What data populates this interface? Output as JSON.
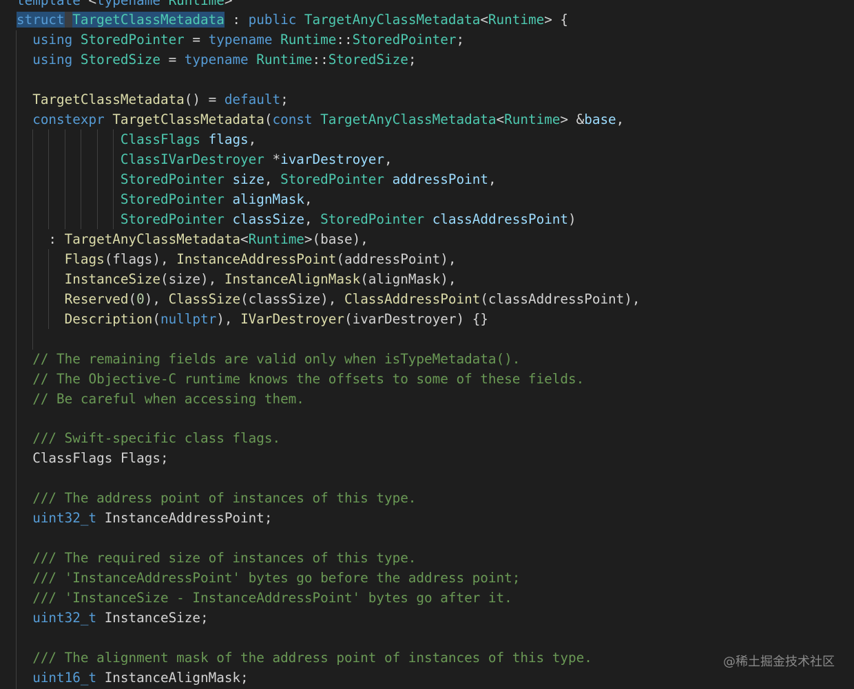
{
  "editor": {
    "language": "cpp",
    "theme_colors": {
      "background": "#1e1e1e",
      "keyword": "#569cd6",
      "type": "#4ec9b0",
      "function": "#dcdcaa",
      "variable": "#9cdcfe",
      "comment": "#6a9955",
      "number": "#b5cea8",
      "plain": "#d4d4d4",
      "selection": "#264f78"
    },
    "lines": [
      [
        [
          "c-k",
          "template"
        ],
        [
          "p",
          " <"
        ],
        [
          "k",
          "typename"
        ],
        [
          "p",
          " "
        ],
        [
          "t",
          "Runtime"
        ],
        [
          "p",
          ">"
        ]
      ],
      [
        [
          "k hl",
          "struct"
        ],
        [
          "p hlw",
          " "
        ],
        [
          "t hl",
          "TargetClassMetadata"
        ],
        [
          "p",
          " : "
        ],
        [
          "k",
          "public"
        ],
        [
          "p",
          " "
        ],
        [
          "t",
          "TargetAnyClassMetadata"
        ],
        [
          "p",
          "<"
        ],
        [
          "t",
          "Runtime"
        ],
        [
          "p",
          "> {"
        ]
      ],
      [
        [
          "p",
          "  "
        ],
        [
          "k",
          "using"
        ],
        [
          "p",
          " "
        ],
        [
          "t",
          "StoredPointer"
        ],
        [
          "p",
          " = "
        ],
        [
          "k",
          "typename"
        ],
        [
          "p",
          " "
        ],
        [
          "t",
          "Runtime"
        ],
        [
          "p",
          "::"
        ],
        [
          "t",
          "StoredPointer"
        ],
        [
          "p",
          ";"
        ]
      ],
      [
        [
          "p",
          "  "
        ],
        [
          "k",
          "using"
        ],
        [
          "p",
          " "
        ],
        [
          "t",
          "StoredSize"
        ],
        [
          "p",
          " = "
        ],
        [
          "k",
          "typename"
        ],
        [
          "p",
          " "
        ],
        [
          "t",
          "Runtime"
        ],
        [
          "p",
          "::"
        ],
        [
          "t",
          "StoredSize"
        ],
        [
          "p",
          ";"
        ]
      ],
      [],
      [
        [
          "p",
          "  "
        ],
        [
          "f",
          "TargetClassMetadata"
        ],
        [
          "p",
          "() = "
        ],
        [
          "k",
          "default"
        ],
        [
          "p",
          ";"
        ]
      ],
      [
        [
          "p",
          "  "
        ],
        [
          "k",
          "constexpr"
        ],
        [
          "p",
          " "
        ],
        [
          "f",
          "TargetClassMetadata"
        ],
        [
          "p",
          "("
        ],
        [
          "k",
          "const"
        ],
        [
          "p",
          " "
        ],
        [
          "t",
          "TargetAnyClassMetadata"
        ],
        [
          "p",
          "<"
        ],
        [
          "t",
          "Runtime"
        ],
        [
          "p",
          "> &"
        ],
        [
          "v",
          "base"
        ],
        [
          "p",
          ","
        ]
      ],
      [
        [
          "p",
          "             "
        ],
        [
          "t",
          "ClassFlags"
        ],
        [
          "p",
          " "
        ],
        [
          "v",
          "flags"
        ],
        [
          "p",
          ","
        ]
      ],
      [
        [
          "p",
          "             "
        ],
        [
          "t",
          "ClassIVarDestroyer"
        ],
        [
          "p",
          " *"
        ],
        [
          "v",
          "ivarDestroyer"
        ],
        [
          "p",
          ","
        ]
      ],
      [
        [
          "p",
          "             "
        ],
        [
          "t",
          "StoredPointer"
        ],
        [
          "p",
          " "
        ],
        [
          "v",
          "size"
        ],
        [
          "p",
          ", "
        ],
        [
          "t",
          "StoredPointer"
        ],
        [
          "p",
          " "
        ],
        [
          "v",
          "addressPoint"
        ],
        [
          "p",
          ","
        ]
      ],
      [
        [
          "p",
          "             "
        ],
        [
          "t",
          "StoredPointer"
        ],
        [
          "p",
          " "
        ],
        [
          "v",
          "alignMask"
        ],
        [
          "p",
          ","
        ]
      ],
      [
        [
          "p",
          "             "
        ],
        [
          "t",
          "StoredPointer"
        ],
        [
          "p",
          " "
        ],
        [
          "v",
          "classSize"
        ],
        [
          "p",
          ", "
        ],
        [
          "t",
          "StoredPointer"
        ],
        [
          "p",
          " "
        ],
        [
          "v",
          "classAddressPoint"
        ],
        [
          "p",
          ")"
        ]
      ],
      [
        [
          "p",
          "    : "
        ],
        [
          "f",
          "TargetAnyClassMetadata"
        ],
        [
          "p",
          "<"
        ],
        [
          "t",
          "Runtime"
        ],
        [
          "p",
          ">(base),"
        ]
      ],
      [
        [
          "p",
          "      "
        ],
        [
          "f",
          "Flags"
        ],
        [
          "p",
          "(flags), "
        ],
        [
          "f",
          "InstanceAddressPoint"
        ],
        [
          "p",
          "(addressPoint),"
        ]
      ],
      [
        [
          "p",
          "      "
        ],
        [
          "f",
          "InstanceSize"
        ],
        [
          "p",
          "(size), "
        ],
        [
          "f",
          "InstanceAlignMask"
        ],
        [
          "p",
          "(alignMask),"
        ]
      ],
      [
        [
          "p",
          "      "
        ],
        [
          "f",
          "Reserved"
        ],
        [
          "p",
          "("
        ],
        [
          "n",
          "0"
        ],
        [
          "p",
          "), "
        ],
        [
          "f",
          "ClassSize"
        ],
        [
          "p",
          "(classSize), "
        ],
        [
          "f",
          "ClassAddressPoint"
        ],
        [
          "p",
          "(classAddressPoint),"
        ]
      ],
      [
        [
          "p",
          "      "
        ],
        [
          "f",
          "Description"
        ],
        [
          "p",
          "("
        ],
        [
          "k",
          "nullptr"
        ],
        [
          "p",
          "), "
        ],
        [
          "f",
          "IVarDestroyer"
        ],
        [
          "p",
          "(ivarDestroyer) {}"
        ]
      ],
      [],
      [
        [
          "p",
          "  "
        ],
        [
          "c",
          "// The remaining fields are valid only when isTypeMetadata()."
        ]
      ],
      [
        [
          "p",
          "  "
        ],
        [
          "c",
          "// The Objective-C runtime knows the offsets to some of these fields."
        ]
      ],
      [
        [
          "p",
          "  "
        ],
        [
          "c",
          "// Be careful when accessing them."
        ]
      ],
      [],
      [
        [
          "p",
          "  "
        ],
        [
          "c",
          "/// Swift-specific class flags."
        ]
      ],
      [
        [
          "p",
          "  "
        ],
        [
          "w",
          "ClassFlags Flags;"
        ]
      ],
      [],
      [
        [
          "p",
          "  "
        ],
        [
          "c",
          "/// The address point of instances of this type."
        ]
      ],
      [
        [
          "p",
          "  "
        ],
        [
          "k",
          "uint32_t"
        ],
        [
          "p",
          " "
        ],
        [
          "w",
          "InstanceAddressPoint;"
        ]
      ],
      [],
      [
        [
          "p",
          "  "
        ],
        [
          "c",
          "/// The required size of instances of this type."
        ]
      ],
      [
        [
          "p",
          "  "
        ],
        [
          "c",
          "/// 'InstanceAddressPoint' bytes go before the address point;"
        ]
      ],
      [
        [
          "p",
          "  "
        ],
        [
          "c",
          "/// 'InstanceSize - InstanceAddressPoint' bytes go after it."
        ]
      ],
      [
        [
          "p",
          "  "
        ],
        [
          "k",
          "uint32_t"
        ],
        [
          "p",
          " "
        ],
        [
          "w",
          "InstanceSize;"
        ]
      ],
      [],
      [
        [
          "p",
          "  "
        ],
        [
          "c",
          "/// The alignment mask of the address point of instances of this type."
        ]
      ],
      [
        [
          "p",
          "  "
        ],
        [
          "k",
          "uint16_t"
        ],
        [
          "p",
          " "
        ],
        [
          "w",
          "InstanceAlignMask;"
        ]
      ]
    ]
  },
  "watermark": "@稀土掘金技术社区"
}
